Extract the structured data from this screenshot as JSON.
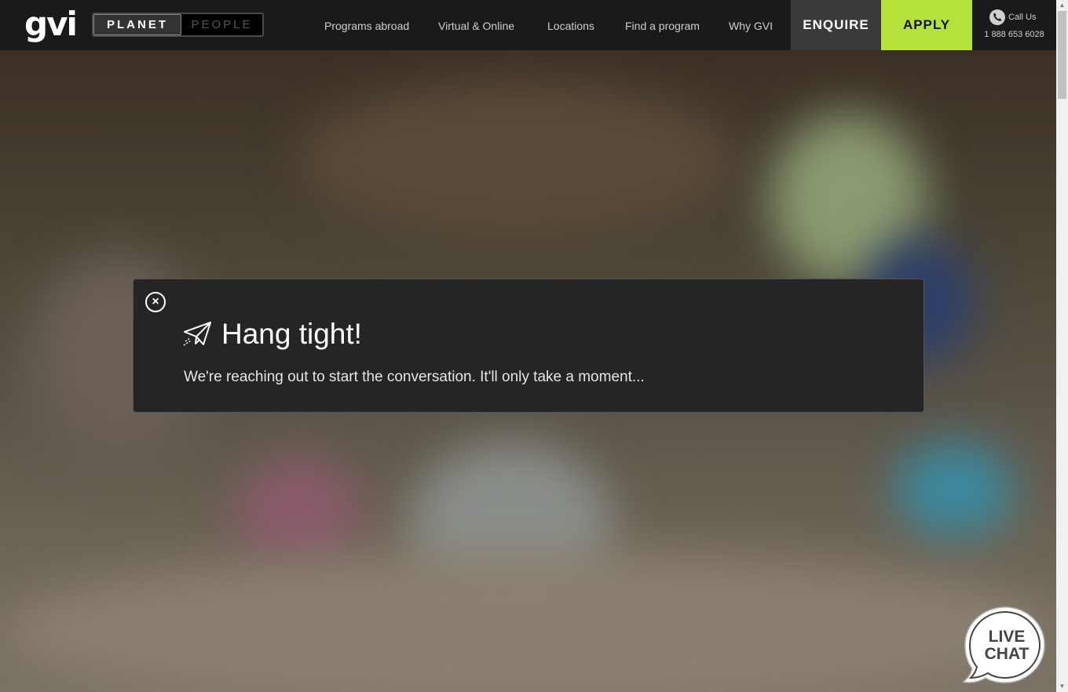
{
  "header": {
    "logo": "gvi",
    "toggle": {
      "planet": "PLANET",
      "people": "PEOPLE"
    },
    "nav": [
      "Programs abroad",
      "Virtual & Online",
      "Locations",
      "Find a program",
      "Why GVI"
    ],
    "enquire": "ENQUIRE",
    "apply": "APPLY",
    "call_label": "Call Us",
    "phone": "1 888 653 6028"
  },
  "modal": {
    "close": "×",
    "title": "Hang tight!",
    "message": "We're reaching out to start the conversation. It'll only take a moment..."
  },
  "livechat": {
    "line1": "LIVE",
    "line2": "CHAT"
  },
  "colors": {
    "apply_bg": "#b6e23c",
    "header_bg": "#1a1a1a",
    "modal_bg": "#252525"
  }
}
